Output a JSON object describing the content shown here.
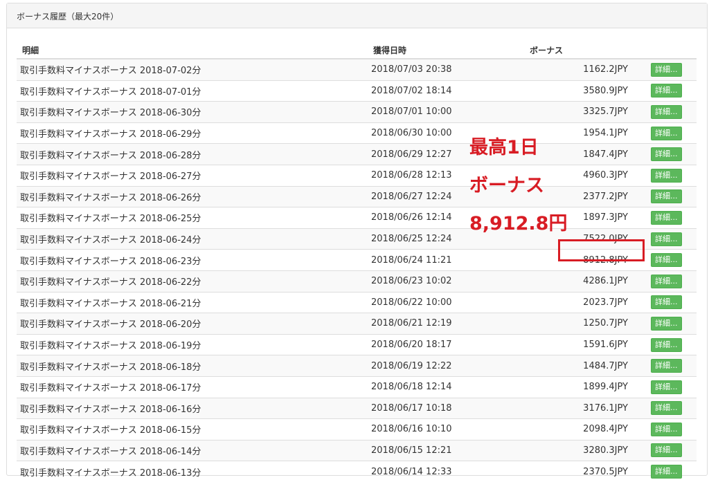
{
  "panel": {
    "title": "ボーナス履歴（最大20件）"
  },
  "table": {
    "headers": {
      "detail": "明細",
      "date": "獲得日時",
      "bonus": "ボーナス"
    },
    "button_label": "詳細...",
    "rows": [
      {
        "detail": "取引手数料マイナスボーナス 2018-07-02分",
        "date": "2018/07/03 20:38",
        "amount": "1162.2JPY"
      },
      {
        "detail": "取引手数料マイナスボーナス 2018-07-01分",
        "date": "2018/07/02 18:14",
        "amount": "3580.9JPY"
      },
      {
        "detail": "取引手数料マイナスボーナス 2018-06-30分",
        "date": "2018/07/01 10:00",
        "amount": "3325.7JPY"
      },
      {
        "detail": "取引手数料マイナスボーナス 2018-06-29分",
        "date": "2018/06/30 10:00",
        "amount": "1954.1JPY"
      },
      {
        "detail": "取引手数料マイナスボーナス 2018-06-28分",
        "date": "2018/06/29 12:27",
        "amount": "1847.4JPY"
      },
      {
        "detail": "取引手数料マイナスボーナス 2018-06-27分",
        "date": "2018/06/28 12:13",
        "amount": "4960.3JPY"
      },
      {
        "detail": "取引手数料マイナスボーナス 2018-06-26分",
        "date": "2018/06/27 12:24",
        "amount": "2377.2JPY"
      },
      {
        "detail": "取引手数料マイナスボーナス 2018-06-25分",
        "date": "2018/06/26 12:14",
        "amount": "1897.3JPY"
      },
      {
        "detail": "取引手数料マイナスボーナス 2018-06-24分",
        "date": "2018/06/25 12:24",
        "amount": "7522.0JPY"
      },
      {
        "detail": "取引手数料マイナスボーナス 2018-06-23分",
        "date": "2018/06/24 11:21",
        "amount": "8912.8JPY"
      },
      {
        "detail": "取引手数料マイナスボーナス 2018-06-22分",
        "date": "2018/06/23 10:02",
        "amount": "4286.1JPY"
      },
      {
        "detail": "取引手数料マイナスボーナス 2018-06-21分",
        "date": "2018/06/22 10:00",
        "amount": "2023.7JPY"
      },
      {
        "detail": "取引手数料マイナスボーナス 2018-06-20分",
        "date": "2018/06/21 12:19",
        "amount": "1250.7JPY"
      },
      {
        "detail": "取引手数料マイナスボーナス 2018-06-19分",
        "date": "2018/06/20 18:17",
        "amount": "1591.6JPY"
      },
      {
        "detail": "取引手数料マイナスボーナス 2018-06-18分",
        "date": "2018/06/19 12:22",
        "amount": "1484.7JPY"
      },
      {
        "detail": "取引手数料マイナスボーナス 2018-06-17分",
        "date": "2018/06/18 12:14",
        "amount": "1899.4JPY"
      },
      {
        "detail": "取引手数料マイナスボーナス 2018-06-16分",
        "date": "2018/06/17 10:18",
        "amount": "3176.1JPY"
      },
      {
        "detail": "取引手数料マイナスボーナス 2018-06-15分",
        "date": "2018/06/16 10:10",
        "amount": "2098.4JPY"
      },
      {
        "detail": "取引手数料マイナスボーナス 2018-06-14分",
        "date": "2018/06/15 12:21",
        "amount": "3280.3JPY"
      },
      {
        "detail": "取引手数料マイナスボーナス 2018-06-13分",
        "date": "2018/06/14 12:33",
        "amount": "2370.5JPY"
      }
    ]
  },
  "annotation": {
    "line1": "最高1日",
    "line2": "ボーナス",
    "line3": "8,912.8円",
    "color": "#d81c24"
  },
  "colors": {
    "button": "#5cb85c",
    "stripe": "#f9f9f9",
    "border": "#dddddd"
  }
}
